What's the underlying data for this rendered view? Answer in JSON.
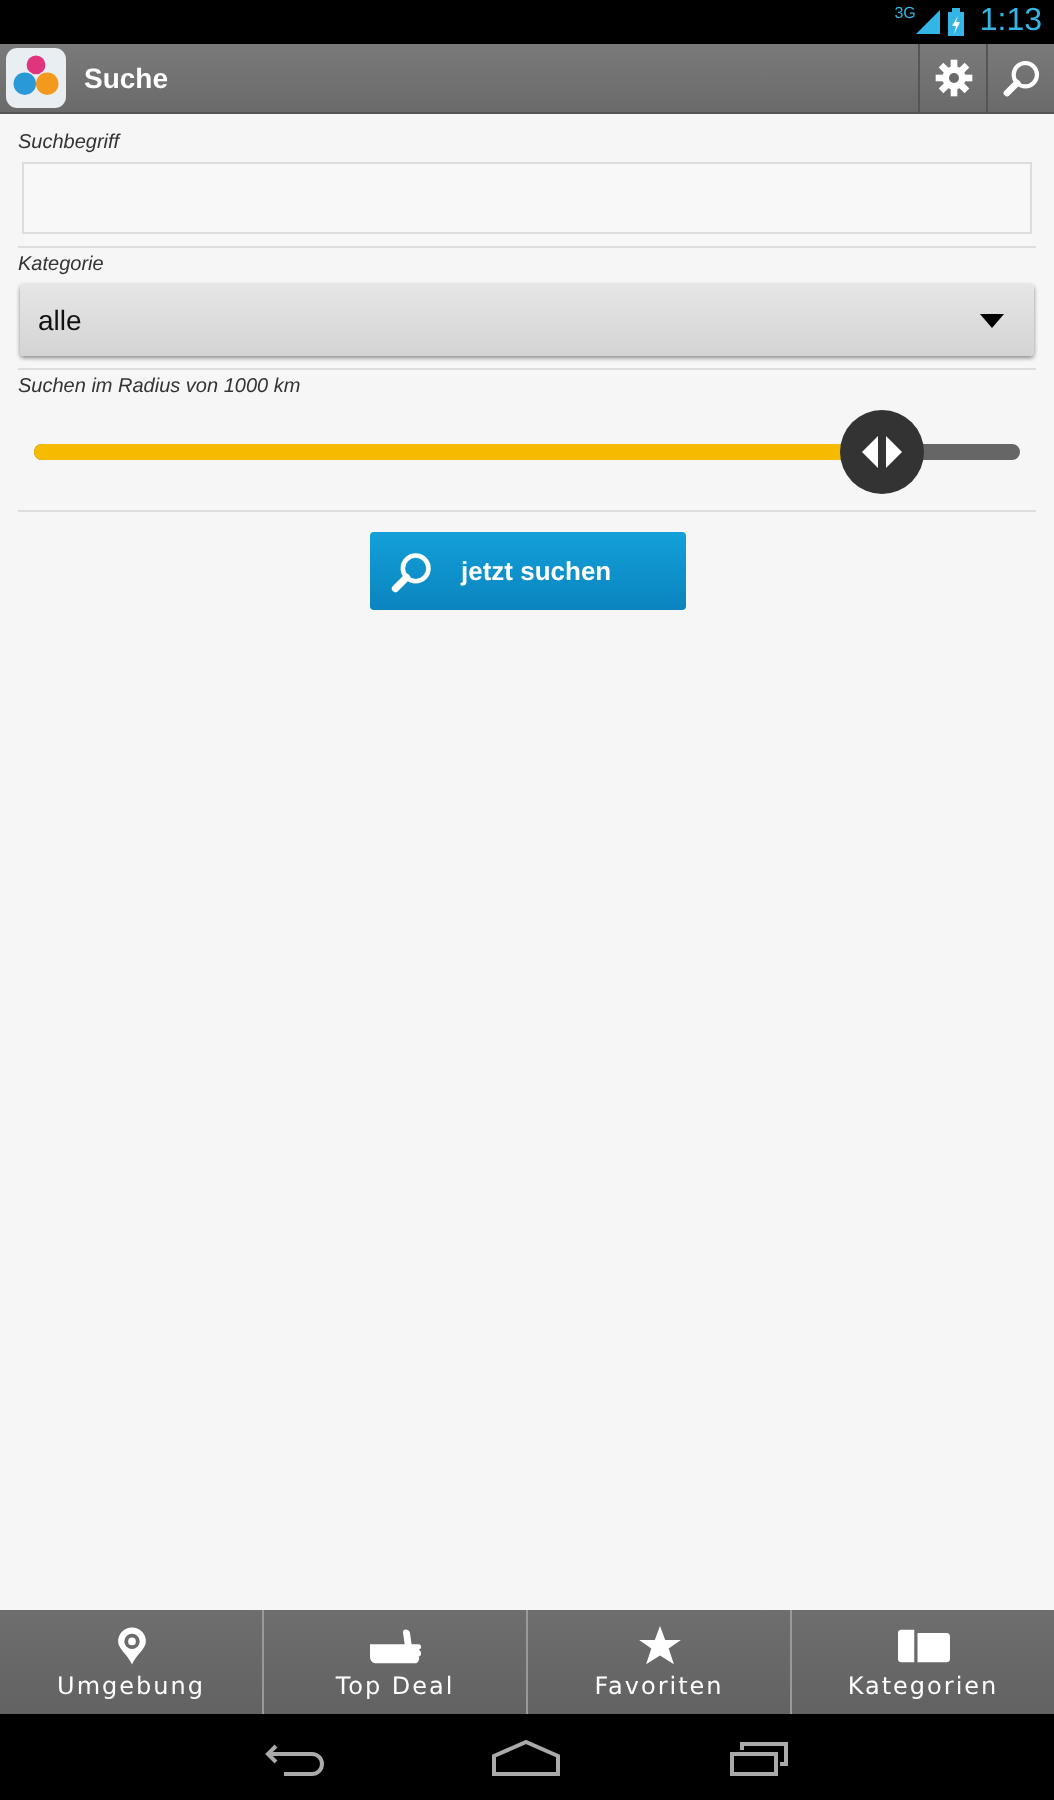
{
  "status_bar": {
    "network": "3G",
    "time": "1:13"
  },
  "action_bar": {
    "title": "Suche"
  },
  "search_term": {
    "label": "Suchbegriff"
  },
  "category": {
    "label": "Kategorie",
    "value": "alle"
  },
  "radius": {
    "label": "Suchen im Radius von 1000 km",
    "level": 0.86
  },
  "search_button": {
    "label": "jetzt suchen"
  },
  "bottom_tabs": [
    {
      "label": "Umgebung",
      "kind": "pin"
    },
    {
      "label": "Top Deal",
      "kind": "thumb"
    },
    {
      "label": "Favoriten",
      "kind": "star"
    },
    {
      "label": "Kategorien",
      "kind": "folder"
    }
  ]
}
